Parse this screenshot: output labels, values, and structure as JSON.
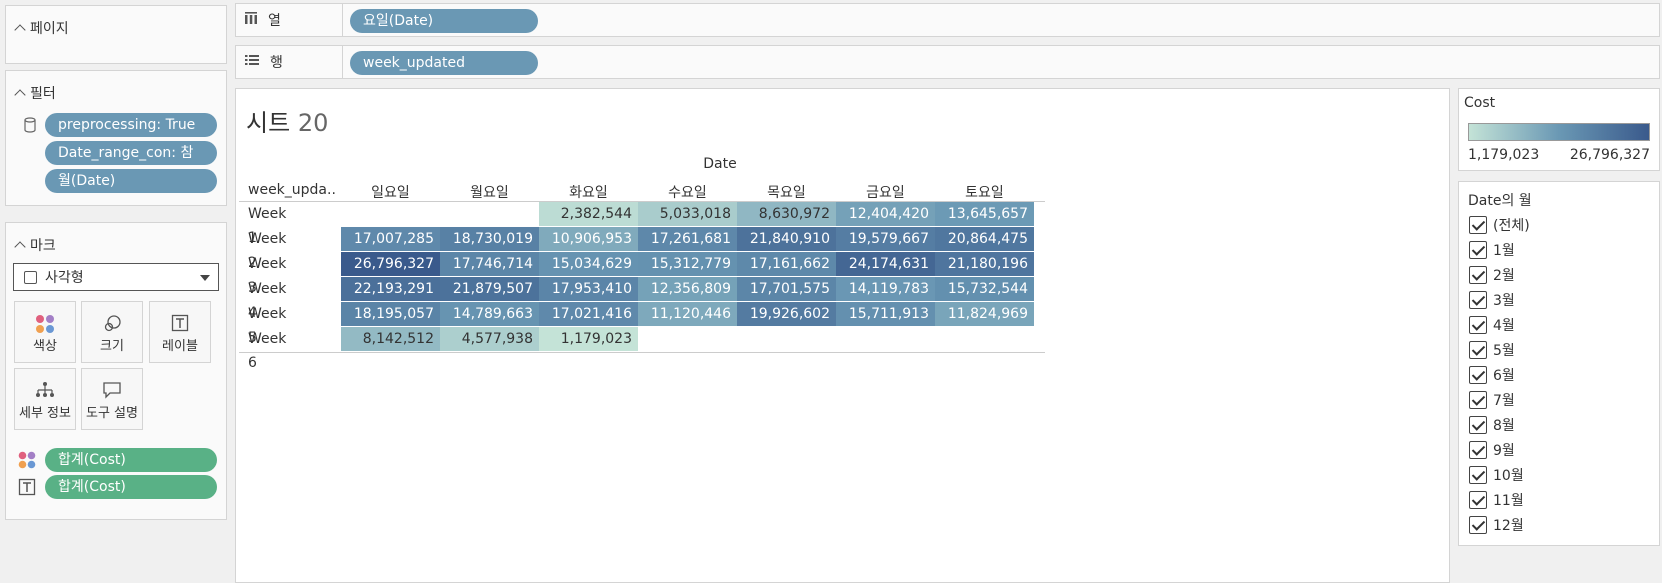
{
  "pages": {
    "title": "페이지"
  },
  "filters": {
    "title": "필터",
    "items": [
      "preprocessing: True",
      "Date_range_con: 참",
      "월(Date)"
    ]
  },
  "marks": {
    "title": "마크",
    "type_select": "사각형",
    "buttons": [
      {
        "label": "색상",
        "icon": "color-icon"
      },
      {
        "label": "크기",
        "icon": "size-icon"
      },
      {
        "label": "레이블",
        "icon": "label-icon"
      },
      {
        "label": "세부 정보",
        "icon": "detail-icon"
      },
      {
        "label": "도구 설명",
        "icon": "tooltip-icon"
      }
    ],
    "fields": [
      {
        "icon": "color-icon",
        "label": "합계(Cost)"
      },
      {
        "icon": "label-icon",
        "label": "합계(Cost)"
      }
    ]
  },
  "shelves": {
    "columns_label": "열",
    "columns_pill": "요일(Date)",
    "rows_label": "행",
    "rows_pill": "week_updated"
  },
  "sheet": {
    "title_text": "시트",
    "title_num": "20",
    "date_header": "Date",
    "row_field_header": "week_upda..",
    "columns": [
      "일요일",
      "월요일",
      "화요일",
      "수요일",
      "목요일",
      "금요일",
      "토요일"
    ],
    "rows": [
      {
        "label": "Week 1",
        "values": [
          null,
          null,
          "2,382,544",
          "5,033,018",
          "8,630,972",
          "12,404,420",
          "13,645,657"
        ]
      },
      {
        "label": "Week 2",
        "values": [
          "17,007,285",
          "18,730,019",
          "10,906,953",
          "17,261,681",
          "21,840,910",
          "19,579,667",
          "20,864,475"
        ]
      },
      {
        "label": "Week 3",
        "values": [
          "26,796,327",
          "17,746,714",
          "15,034,629",
          "15,312,779",
          "17,161,662",
          "24,174,631",
          "21,180,196"
        ]
      },
      {
        "label": "Week 4",
        "values": [
          "22,193,291",
          "21,879,507",
          "17,953,410",
          "12,356,809",
          "17,701,575",
          "14,119,783",
          "15,732,544"
        ]
      },
      {
        "label": "Week 5",
        "values": [
          "18,195,057",
          "14,789,663",
          "17,021,416",
          "11,120,446",
          "19,926,602",
          "15,711,913",
          "11,824,969"
        ]
      },
      {
        "label": "Week 6",
        "values": [
          "8,142,512",
          "4,577,938",
          "1,179,023",
          null,
          null,
          null,
          null
        ]
      }
    ]
  },
  "cost_legend": {
    "title": "Cost",
    "min_label": "1,179,023",
    "max_label": "26,796,327",
    "min": 1179023,
    "max": 26796327,
    "color_low": "#c4e3d7",
    "color_high": "#3a5a8c"
  },
  "month_filter": {
    "title": "Date의 월",
    "items": [
      "(전체)",
      "1월",
      "2월",
      "3월",
      "4월",
      "5월",
      "6월",
      "7월",
      "8월",
      "9월",
      "10월",
      "11월",
      "12월"
    ]
  }
}
